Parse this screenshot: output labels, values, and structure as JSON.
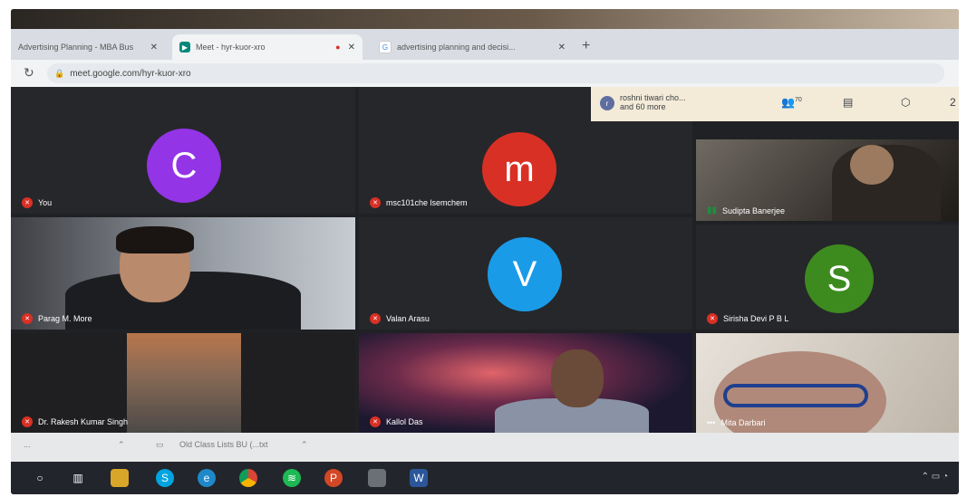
{
  "browser": {
    "tabs": [
      {
        "label": "Advertising Planning - MBA Bus",
        "close": "✕"
      },
      {
        "label": "Meet - hyr-kuor-xro",
        "close": "✕"
      },
      {
        "label": "advertising planning and decisi...",
        "close": "✕"
      }
    ],
    "new_tab": "+",
    "url": "meet.google.com/hyr-kuor-xro"
  },
  "meet": {
    "header": {
      "people_line1": "roshni tiwari cho...",
      "people_line2": "and 60 more",
      "people_initial": "r",
      "participant_count": "70",
      "icon_count": "2"
    },
    "tiles": [
      {
        "name": "You",
        "initial": "C",
        "color": "#9334e6"
      },
      {
        "name": "msc101che lsemchem",
        "initial": "m",
        "color": "#d93025"
      },
      {
        "name": "Sudipta Banerjee"
      },
      {
        "name": "Parag M. More"
      },
      {
        "name": "Valan Arasu",
        "initial": "V",
        "color": "#1a9be8"
      },
      {
        "name": "Sirisha Devi P B L",
        "initial": "S",
        "color": "#3d8b1f"
      },
      {
        "name": "Dr. Rakesh Kumar Singh"
      },
      {
        "name": "Kallol Das"
      },
      {
        "name": "Mita Darbari"
      }
    ]
  },
  "downloads": [
    {
      "label": "..."
    },
    {
      "label": "Old Class Lists BU (...txt"
    }
  ],
  "colors": {
    "tile_bg": "#2b2c2f",
    "meet_bg": "#202124",
    "mic_off": "#d93025"
  }
}
